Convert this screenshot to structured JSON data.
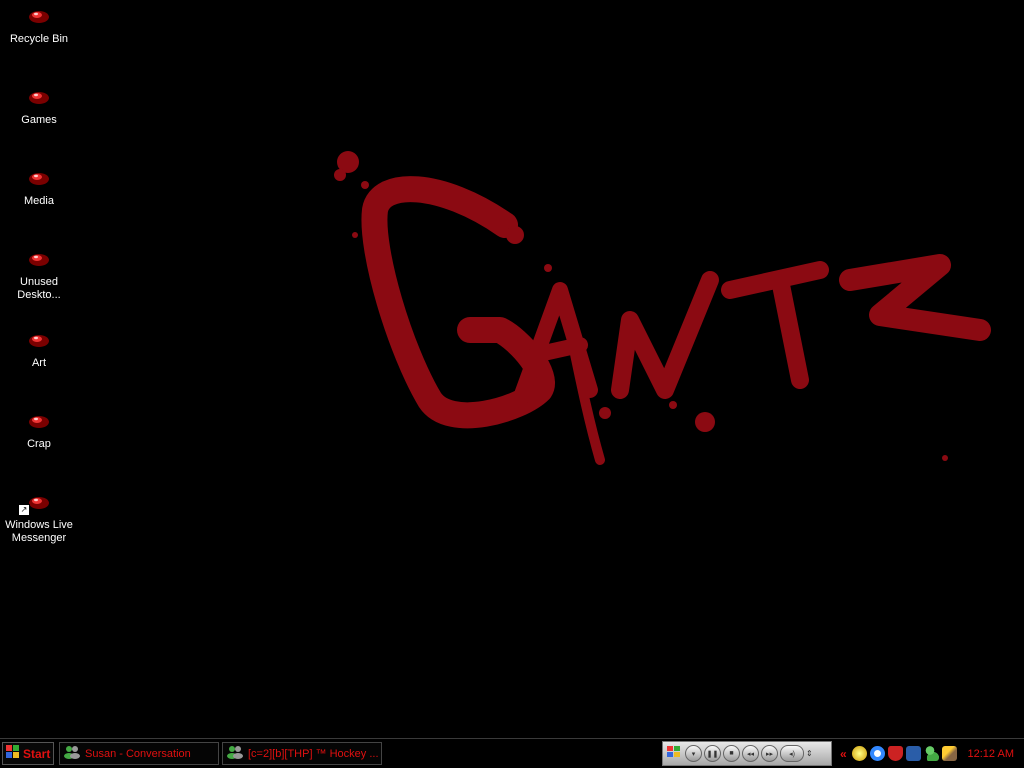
{
  "desktop": {
    "icons": [
      {
        "label": "Recycle Bin",
        "icon": "recycle-bin-icon"
      },
      {
        "label": "Games",
        "icon": "folder-icon"
      },
      {
        "label": "Media",
        "icon": "folder-icon"
      },
      {
        "label": "Unused Deskto...",
        "icon": "folder-icon"
      },
      {
        "label": "Art",
        "icon": "folder-icon"
      },
      {
        "label": "Crap",
        "icon": "folder-icon"
      },
      {
        "label": "Windows Live Messenger",
        "icon": "messenger-shortcut-icon"
      }
    ],
    "wallpaper_logo_color": "#8b0a12",
    "background_color": "#000000"
  },
  "taskbar": {
    "start_label": "Start",
    "tasks": [
      {
        "label": "Susan - Conversation",
        "icon": "messenger-icon"
      },
      {
        "label": "[c=2][b][THP] ™ Hockey ...",
        "icon": "messenger-icon"
      }
    ],
    "media_controls": [
      "windows-logo-icon",
      "menu-icon",
      "pause-icon",
      "stop-icon",
      "previous-icon",
      "next-icon",
      "volume-icon"
    ],
    "tray_chevron": "«",
    "tray_icons": [
      "winamp-icon",
      "quicktime-icon",
      "antivirus-icon",
      "ati-icon",
      "messenger-tray-icon",
      "power-icon"
    ],
    "clock": "12:12 AM",
    "accent_color": "#e01010"
  }
}
